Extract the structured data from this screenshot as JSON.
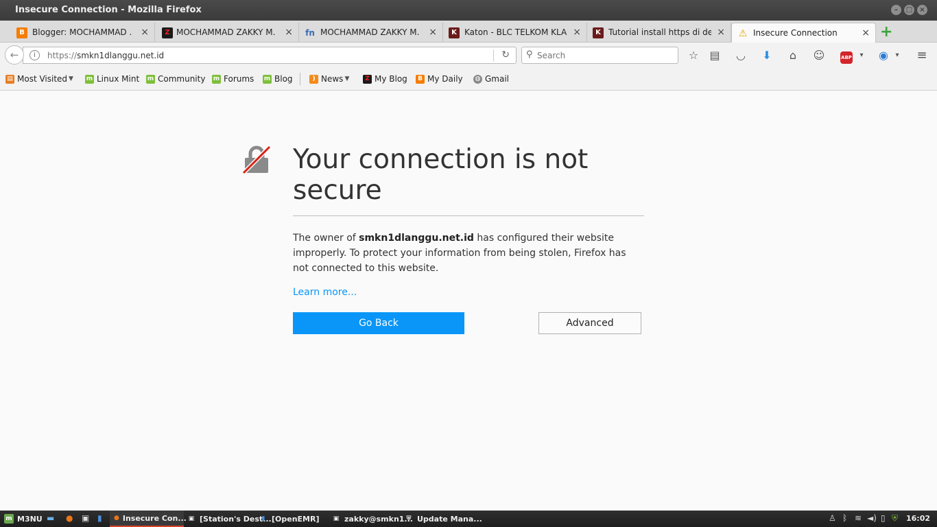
{
  "window": {
    "title": "Insecure Connection - Mozilla Firefox"
  },
  "tabs": [
    {
      "label": "Blogger: MOCHAMMAD ...",
      "favicon": "blogger-icon",
      "color": "#f57d00",
      "glyph": "B"
    },
    {
      "label": "MOCHAMMAD ZAKKY M.",
      "favicon": "zakky-z-icon",
      "color": "#1a1a1a",
      "glyph": "Z"
    },
    {
      "label": "MOCHAMMAD ZAKKY M.",
      "favicon": "fn-icon",
      "color": "#3b6cb5",
      "glyph": "fn"
    },
    {
      "label": "Katon - BLC TELKOM KLA...",
      "favicon": "blc-icon",
      "color": "#6b1b1b",
      "glyph": "K"
    },
    {
      "label": "Tutorial install https di de...",
      "favicon": "blc-icon",
      "color": "#6b1b1b",
      "glyph": "K"
    },
    {
      "label": "Insecure Connection",
      "favicon": "warning-icon",
      "color": "#e8a400",
      "glyph": "!"
    }
  ],
  "nav": {
    "url_protocol": "https://",
    "url_host": "smkn1dlanggu.net.id",
    "search_placeholder": "Search"
  },
  "bookmarks": [
    {
      "label": "Most Visited",
      "icon": "most-visited-icon",
      "color": "#e67e22",
      "dropdown": true
    },
    {
      "label": "Linux Mint",
      "icon": "mint-icon",
      "color": "#7ebf3a",
      "dropdown": false
    },
    {
      "label": "Community",
      "icon": "mint-icon",
      "color": "#7ebf3a",
      "dropdown": false
    },
    {
      "label": "Forums",
      "icon": "mint-icon",
      "color": "#7ebf3a",
      "dropdown": false
    },
    {
      "label": "Blog",
      "icon": "mint-icon",
      "color": "#7ebf3a",
      "dropdown": false
    },
    {
      "label": "News",
      "icon": "rss-icon",
      "color": "#f48a1c",
      "dropdown": true
    },
    {
      "label": "My Blog",
      "icon": "zakky-z-icon",
      "color": "#1a1a1a",
      "dropdown": false
    },
    {
      "label": "My Daily",
      "icon": "blogger-icon",
      "color": "#f57d00",
      "dropdown": false
    },
    {
      "label": "Gmail",
      "icon": "globe-icon",
      "color": "#8a8a8a",
      "dropdown": false
    }
  ],
  "error": {
    "title": "Your connection is not secure",
    "desc_prefix": "The owner of ",
    "desc_host": "smkn1dlanggu.net.id",
    "desc_suffix": " has configured their website improperly. To protect your information from being stolen, Firefox has not connected to this website.",
    "learn_more": "Learn more...",
    "go_back": "Go Back",
    "advanced": "Advanced"
  },
  "taskbar": {
    "menu_label": "M3NU",
    "items": [
      {
        "label": "Insecure Con...",
        "icon": "firefox-icon",
        "active": true
      },
      {
        "label": "[Station's Dest...",
        "icon": "terminal-icon",
        "active": false
      },
      {
        "label": "[OpenEMR]",
        "icon": "book-icon",
        "active": false
      },
      {
        "label": "zakky@smkn1...",
        "icon": "terminal-icon",
        "active": false
      },
      {
        "label": "Update Mana...",
        "icon": "shield-icon",
        "active": false
      }
    ],
    "clock": "16:02"
  },
  "colors": {
    "accent": "#0996f8",
    "lock_strike": "#d92215"
  }
}
